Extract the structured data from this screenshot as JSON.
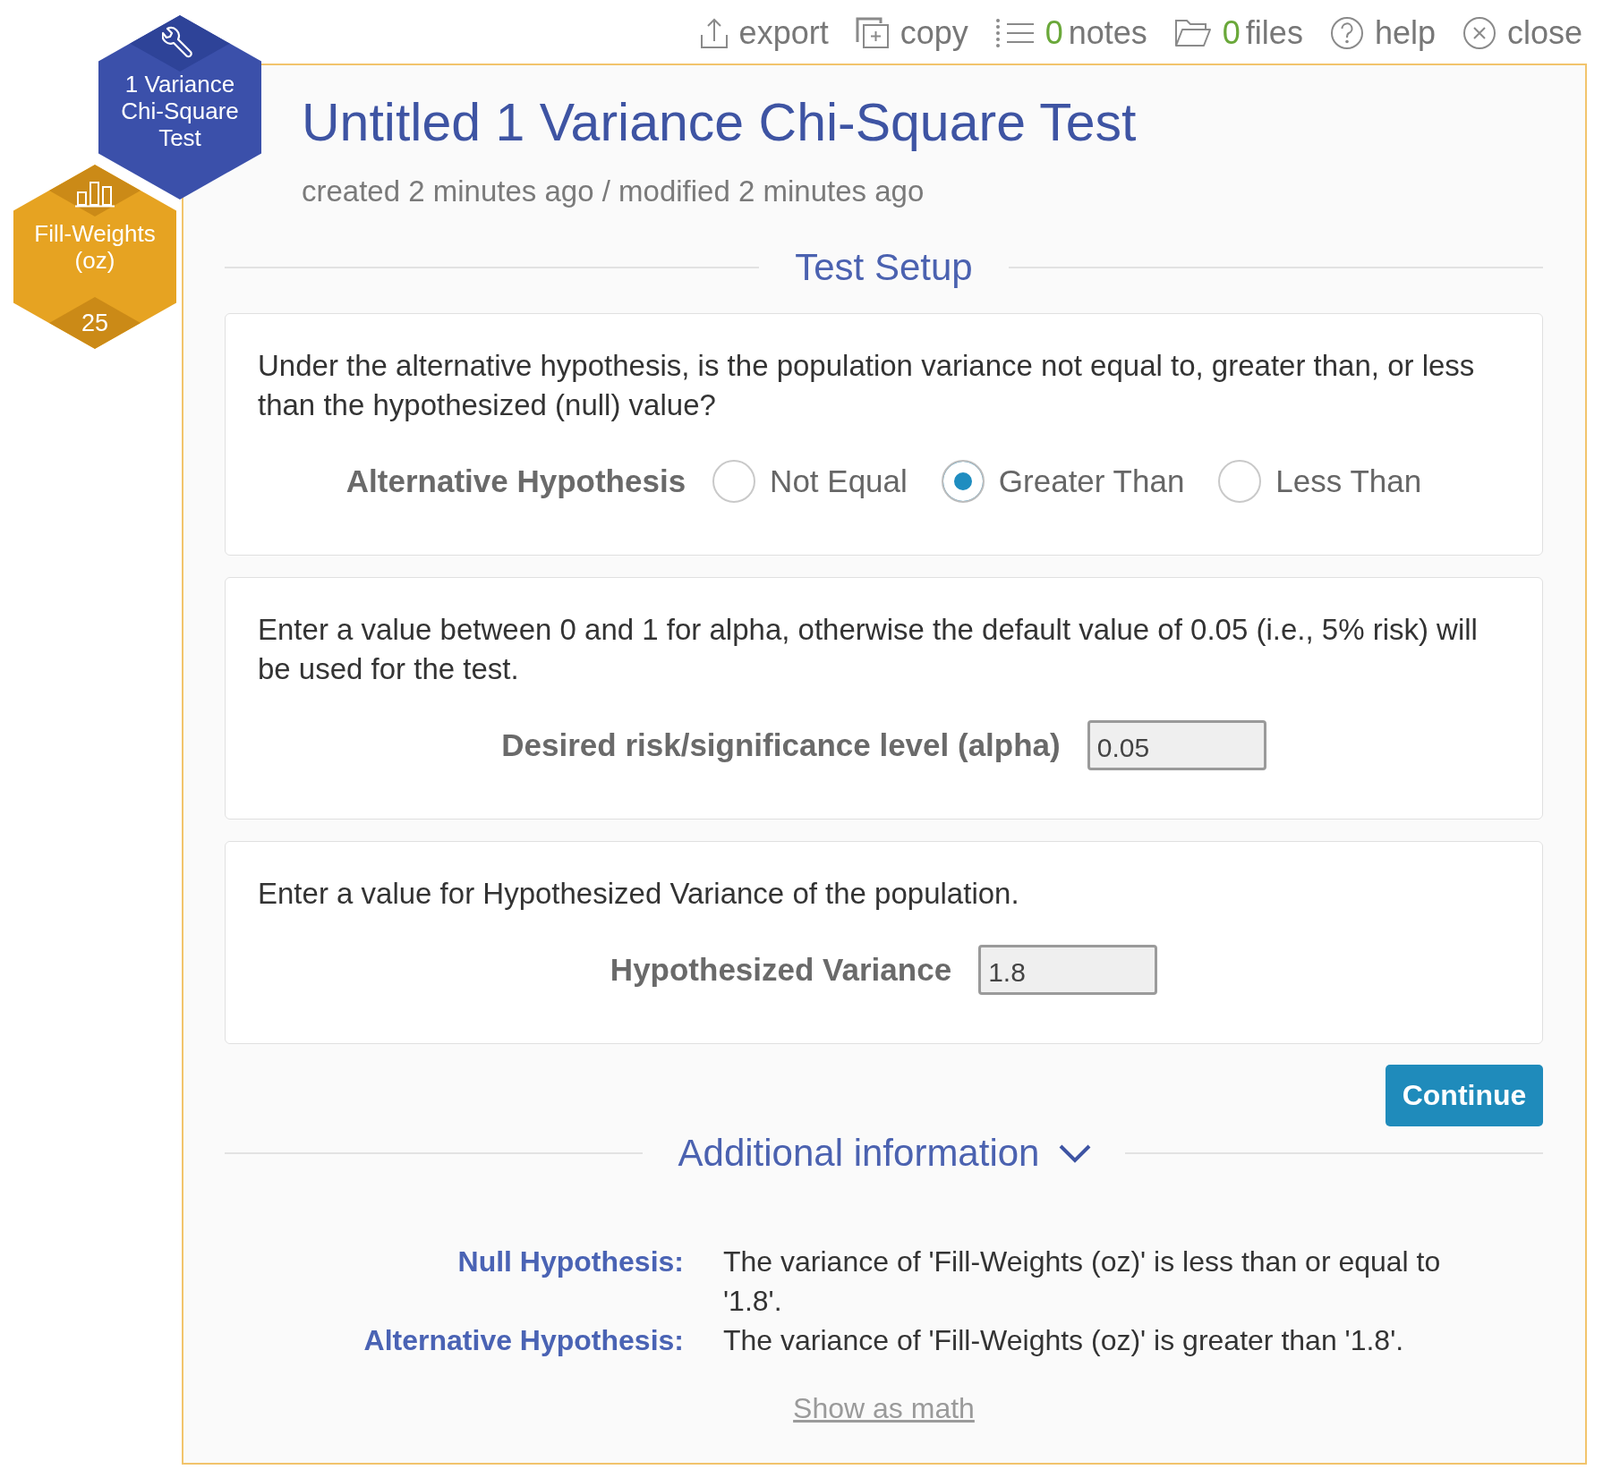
{
  "toolbar": [
    {
      "kind": "action",
      "label": "export"
    },
    {
      "kind": "action",
      "label": "copy"
    },
    {
      "kind": "counter",
      "count": "0",
      "label": "notes"
    },
    {
      "kind": "counter",
      "count": "0",
      "label": "files"
    },
    {
      "kind": "action",
      "label": "help"
    },
    {
      "kind": "action",
      "label": "close"
    }
  ],
  "badges": [
    {
      "kind": "tool",
      "label": "1 Variance Chi-Square Test"
    },
    {
      "kind": "data",
      "label": "Fill-Weights (oz)",
      "count": "25"
    }
  ],
  "header": {
    "title": "Untitled 1 Variance Chi-Square Test",
    "meta": "created 2 minutes ago / modified 2 minutes ago"
  },
  "test_setup": {
    "heading": "Test Setup",
    "cards": [
      {
        "kind": "radio",
        "prompt": "Under the alternative hypothesis, is the population variance not equal to, greater than, or less than the hypothesized (null) value?",
        "label": "Alternative Hypothesis",
        "options": [
          {
            "label": "Not Equal",
            "selected": false
          },
          {
            "label": "Greater Than",
            "selected": true
          },
          {
            "label": "Less Than",
            "selected": false
          }
        ]
      },
      {
        "kind": "input",
        "prompt": "Enter a value between 0 and 1 for alpha, otherwise the default value of 0.05 (i.e., 5% risk) will be used for the test.",
        "label": "Desired risk/significance level (alpha)",
        "value": "0.05"
      },
      {
        "kind": "input",
        "prompt": "Enter a value for Hypothesized Variance of the population.",
        "label": "Hypothesized Variance",
        "value": "1.8"
      }
    ],
    "continue_button": "Continue"
  },
  "additional_info": {
    "heading": "Additional information",
    "rows": [
      {
        "label": "Null Hypothesis:",
        "text": "The variance of 'Fill-Weights (oz)' is less than or equal to '1.8'."
      },
      {
        "label": "Alternative Hypothesis:",
        "text": "The variance of 'Fill-Weights (oz)' is greater than '1.8'."
      }
    ],
    "link": "Show as math"
  }
}
